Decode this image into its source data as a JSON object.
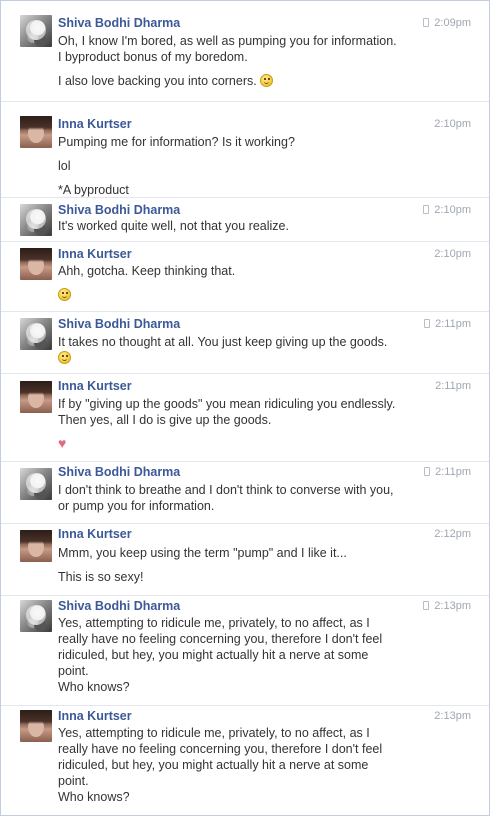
{
  "participants": {
    "shiva": "Shiva Bodhi Dharma",
    "inna": "Inna Kurtser"
  },
  "messages": [
    {
      "sender": "Shiva Bodhi Dharma",
      "time": "2:09pm",
      "mobile": true,
      "lines": [
        "Oh, I know I'm bored, as well as pumping you for information.",
        "I byproduct bonus of my boredom.",
        "",
        "I also love backing you into corners."
      ]
    },
    {
      "sender": "Inna Kurtser",
      "time": "2:10pm",
      "mobile": false,
      "lines": [
        "Pumping me for information? Is it working?",
        "",
        "lol",
        "",
        "*A byproduct"
      ]
    },
    {
      "sender": "Shiva Bodhi Dharma",
      "time": "2:10pm",
      "mobile": true,
      "lines": [
        "It's worked quite well, not that you realize."
      ]
    },
    {
      "sender": "Inna Kurtser",
      "time": "2:10pm",
      "mobile": false,
      "lines": [
        "Ahh, gotcha. Keep thinking that."
      ]
    },
    {
      "sender": "Shiva Bodhi Dharma",
      "time": "2:11pm",
      "mobile": true,
      "lines": [
        "It takes no thought at all. You just keep giving up the goods."
      ]
    },
    {
      "sender": "Inna Kurtser",
      "time": "2:11pm",
      "mobile": false,
      "lines": [
        "If by \"giving up the goods\" you mean ridiculing you endlessly.",
        "Then yes, all I do is give up the goods."
      ]
    },
    {
      "sender": "Shiva Bodhi Dharma",
      "time": "2:11pm",
      "mobile": true,
      "lines": [
        "I don't think to breathe and I don't think to converse with you,",
        "or pump you for information."
      ]
    },
    {
      "sender": "Inna Kurtser",
      "time": "2:12pm",
      "mobile": false,
      "lines": [
        "Mmm, you keep using the term \"pump\" and I like it...",
        "",
        "This is so sexy!"
      ]
    },
    {
      "sender": "Shiva Bodhi Dharma",
      "time": "2:13pm",
      "mobile": true,
      "lines": [
        "Yes, attempting to ridicule me, privately, to no affect, as I",
        "really have no feeling concerning you, therefore I don't feel",
        "ridiculed, but hey, you might actually hit a nerve at some",
        "point.",
        "Who knows?"
      ]
    },
    {
      "sender": "Inna Kurtser",
      "time": "2:13pm",
      "mobile": false,
      "lines": [
        "Yes, attempting to ridicule me, privately, to no affect, as I",
        "really have no feeling concerning you, therefore I don't feel",
        "ridiculed, but hey, you might actually hit a nerve at some",
        "point.",
        "Who knows?"
      ]
    }
  ],
  "icons": {
    "smiley": "smiley-emoji-icon",
    "heart": "heart-emoji-icon",
    "mobile": "mobile-phone-icon"
  },
  "colors": {
    "name": "#3b5998",
    "text": "#333333",
    "timestamp": "#a0a7b2",
    "divider": "#e3e6ec"
  }
}
